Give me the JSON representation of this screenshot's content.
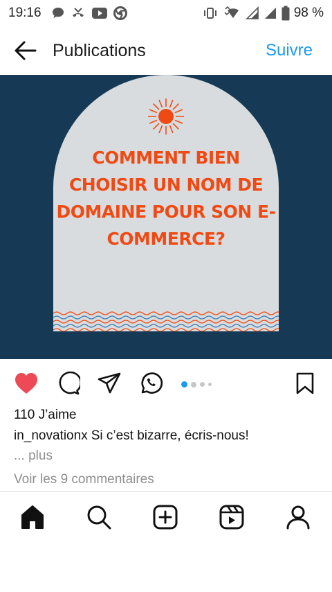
{
  "status_bar": {
    "time": "19:16",
    "battery_percent": "98 %",
    "notification_icons": [
      "chat-bubble-icon",
      "missed-call-icon",
      "youtube-icon",
      "chrome-icon"
    ],
    "system_icons": [
      "vibrate-icon",
      "wifi-icon",
      "signal-icon",
      "signal-icon",
      "battery-icon"
    ]
  },
  "header": {
    "title": "Publications",
    "follow_label": "Suivre",
    "back_icon": "arrow-left-icon"
  },
  "post": {
    "image": {
      "headline": "COMMENT BIEN CHOISIR UN NOM DE DOMAINE POUR SON E-COMMERCE?",
      "background_color": "#163a55",
      "card_color": "#d9dcde",
      "accent_color": "#f04a14",
      "wave_colors": [
        "#f04a14",
        "#3a7bb0"
      ]
    },
    "actions": {
      "icons": [
        "heart-filled-icon",
        "comment-icon",
        "share-icon",
        "whatsapp-icon",
        "bookmark-icon"
      ],
      "liked": true,
      "like_color": "#ed4956",
      "carousel_dots": 4,
      "carousel_active_index": 0
    },
    "likes_text": "110 J’aime",
    "caption": {
      "username": "in_novationx",
      "text": "Si c’est bizarre, écris-nous!"
    },
    "more_label": "... plus",
    "view_comments_label": "Voir les 9 commentaires"
  },
  "bottom_nav": {
    "items": [
      "home-icon",
      "search-icon",
      "create-icon",
      "reels-icon",
      "profile-icon"
    ],
    "active_index": 0
  },
  "colors": {
    "link_blue": "#1a9af0",
    "muted_text": "#8e8e8e"
  }
}
